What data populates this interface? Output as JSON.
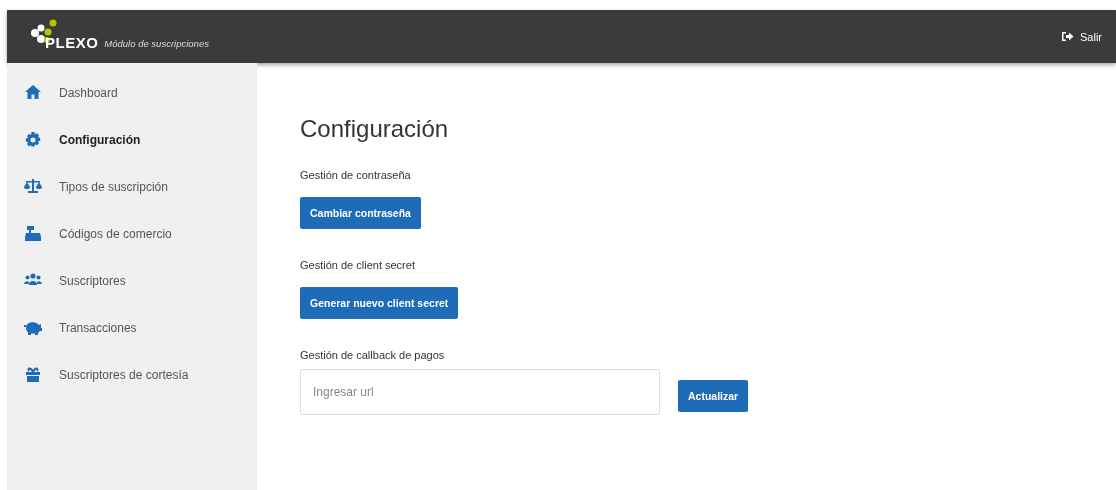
{
  "header": {
    "brand": "PLEXO",
    "subtitle": "Módulo de suscripciones",
    "logout": "Salir"
  },
  "sidebar": {
    "items": [
      {
        "label": "Dashboard",
        "selected": false
      },
      {
        "label": "Configuración",
        "selected": true
      },
      {
        "label": "Tipos de suscripción",
        "selected": false
      },
      {
        "label": "Códigos de comercio",
        "selected": false
      },
      {
        "label": "Suscriptores",
        "selected": false
      },
      {
        "label": "Transacciones",
        "selected": false
      },
      {
        "label": "Suscriptores de cortesía",
        "selected": false
      }
    ]
  },
  "page": {
    "title": "Configuración",
    "sections": [
      {
        "heading": "Gestión de contraseña",
        "kind": "button",
        "button": "Cambiar contraseña"
      },
      {
        "heading": "Gestión de client secret",
        "kind": "button",
        "button": "Generar nuevo client secret"
      },
      {
        "heading": "Gestión de callback de pagos",
        "kind": "input",
        "placeholder": "Ingresar url",
        "button": "Actualizar"
      }
    ]
  }
}
